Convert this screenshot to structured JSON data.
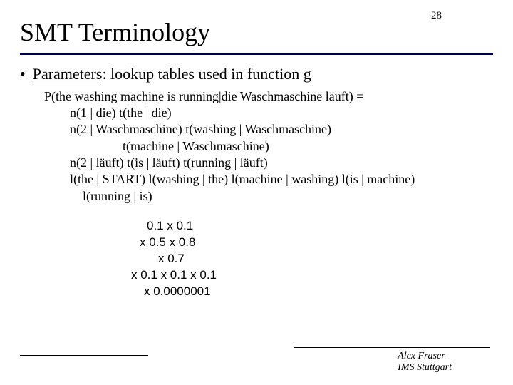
{
  "page_number": "28",
  "title": "SMT Terminology",
  "bullet": {
    "label": "Parameters",
    "rest": ": lookup tables used in function g"
  },
  "example": {
    "line0": "P(the washing machine is running|die Waschmaschine läuft) =",
    "line1": "n(1 | die) t(the | die)",
    "line2": "n(2 | Waschmaschine)  t(washing | Waschmaschine)",
    "line3": "t(machine | Waschmaschine)",
    "line4": "n(2 | läuft) t(is | läuft) t(running | läuft)",
    "line5": "l(the | START) l(washing | the) l(machine | washing) l(is | machine)",
    "line6": "l(running | is)"
  },
  "calc": {
    "l0": "0.1 x 0.1",
    "l1": "x 0.5 x 0.8",
    "l2": "x 0.7",
    "l3": "x 0.1 x 0.1 x 0.1",
    "l4": "x 0.0000001"
  },
  "footer": {
    "author": "Alex Fraser",
    "affiliation": "IMS Stuttgart"
  }
}
